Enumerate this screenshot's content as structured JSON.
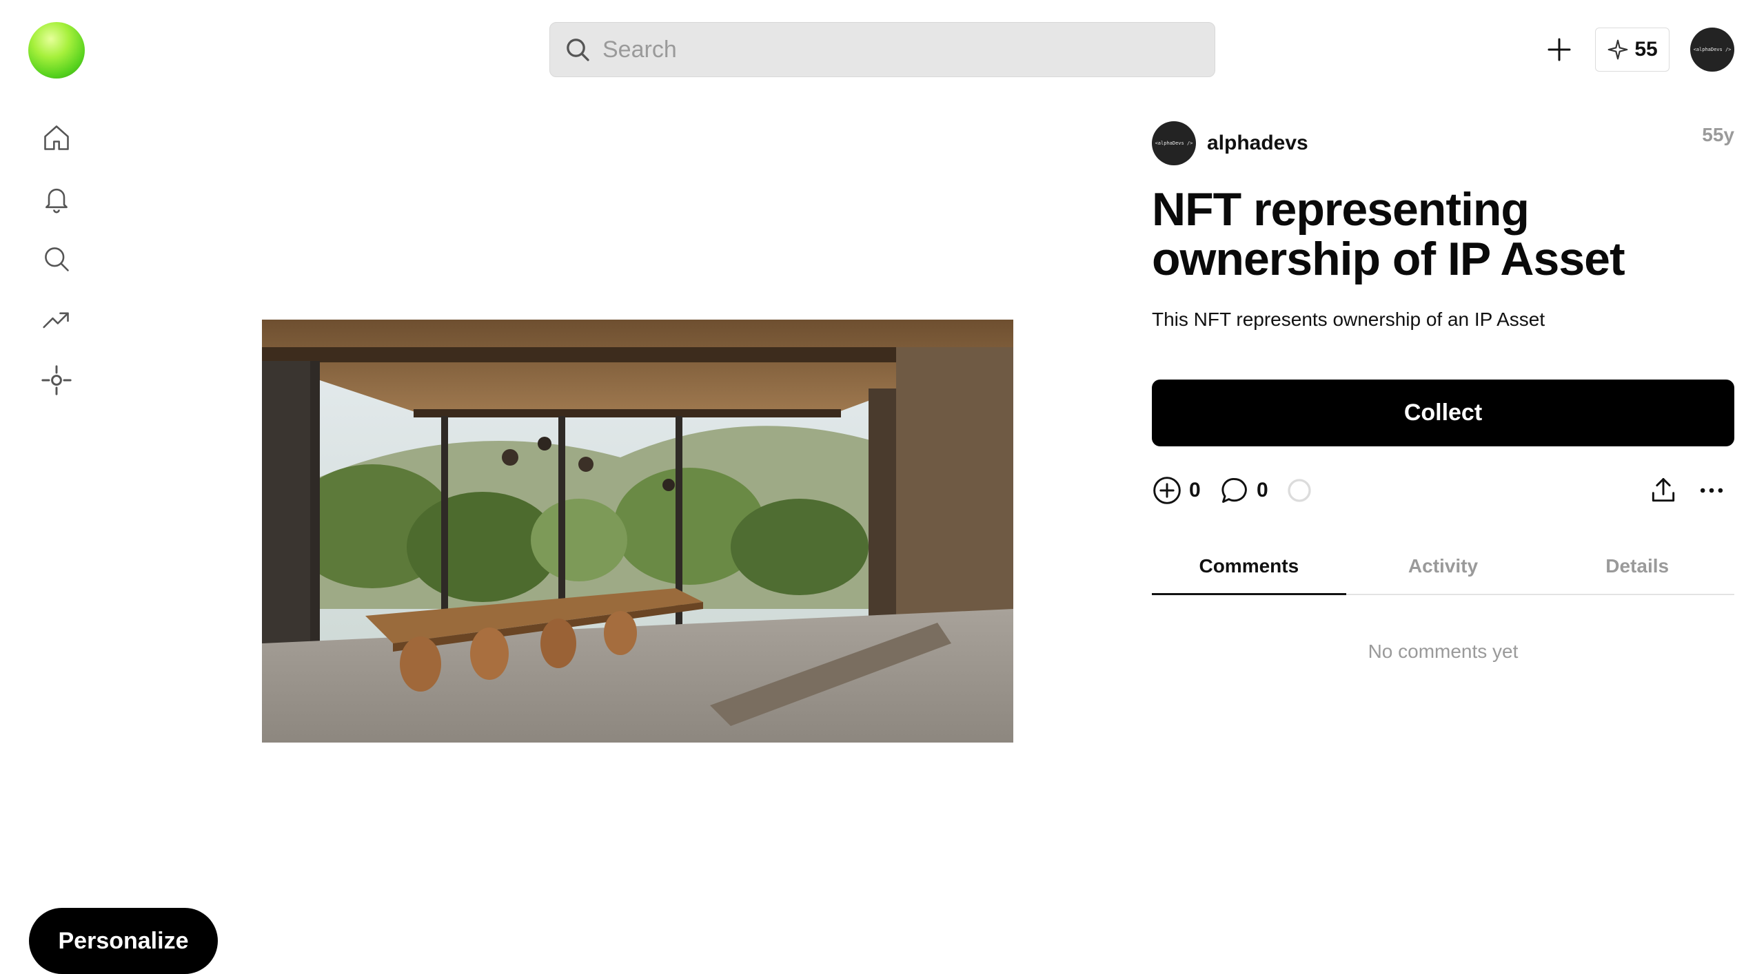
{
  "header": {
    "search_placeholder": "Search",
    "points": "55",
    "avatar_text": "<alphaDevs />"
  },
  "nav": {
    "items": [
      {
        "icon": "home-icon"
      },
      {
        "icon": "bell-icon"
      },
      {
        "icon": "search-icon"
      },
      {
        "icon": "trending-icon"
      },
      {
        "icon": "crosshair-icon"
      }
    ]
  },
  "post": {
    "author": "alphadevs",
    "author_avatar_text": "<alphaDevs />",
    "age": "55y",
    "title": "NFT representing ownership of IP Asset",
    "description": "This NFT represents ownership of an IP Asset",
    "collect_label": "Collect",
    "collect_count": "0",
    "comment_count": "0"
  },
  "tabs": [
    "Comments",
    "Activity",
    "Details"
  ],
  "comments": {
    "empty_text": "No comments yet"
  },
  "personalize_label": "Personalize",
  "colors": {
    "accent": "#000000",
    "muted": "#9a9a9a",
    "logo": "#57d21e"
  }
}
